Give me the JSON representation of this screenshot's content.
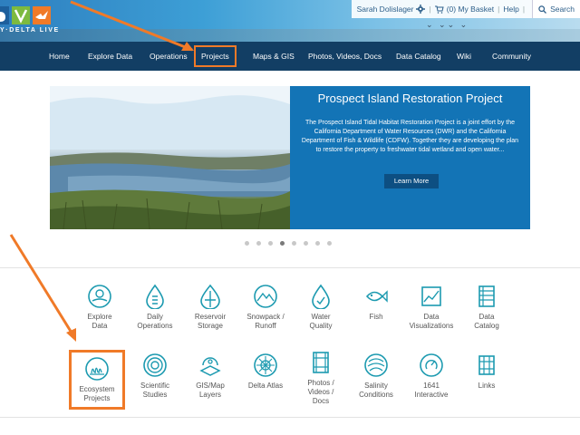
{
  "header": {
    "logo_text": "Y·DELTA LIVE",
    "user_name": "Sarah Dolislager",
    "basket": "(0) My Basket",
    "help": "Help",
    "search": "Search"
  },
  "nav": {
    "items": [
      {
        "label": "Home"
      },
      {
        "label": "Explore Data"
      },
      {
        "label": "Operations"
      },
      {
        "label": "Projects"
      },
      {
        "label": "Maps & GIS"
      },
      {
        "label": "Photos, Videos, Docs"
      },
      {
        "label": "Data Catalog"
      },
      {
        "label": "Wiki"
      },
      {
        "label": "Community"
      }
    ],
    "active": "Projects"
  },
  "hero": {
    "title": "Prospect Island Restoration Project",
    "description": "The Prospect Island Tidal Habitat Restoration Project is a joint effort by the California Department of Water Resources (DWR) and the California Department of Fish & Wildlife (CDFW). Together they are developing the plan to restore the property to freshwater tidal wetland and open water...",
    "button": "Learn More",
    "slides": 8,
    "active_slide": 4
  },
  "tiles": [
    {
      "label": "Explore\nData",
      "icon": "map-pin-icon"
    },
    {
      "label": "Daily\nOperations",
      "icon": "water-drop-icon"
    },
    {
      "label": "Reservoir\nStorage",
      "icon": "reservoir-icon"
    },
    {
      "label": "Snowpack /\nRunoff",
      "icon": "mountain-icon"
    },
    {
      "label": "Water\nQuality",
      "icon": "drop-check-icon"
    },
    {
      "label": "Fish",
      "icon": "fish-icon"
    },
    {
      "label": "Data\nVisualizations",
      "icon": "chart-icon"
    },
    {
      "label": "Data\nCatalog",
      "icon": "catalog-icon"
    },
    {
      "label": "Ecosystem\nProjects",
      "icon": "ecosystem-icon"
    },
    {
      "label": "Scientific\nStudies",
      "icon": "target-icon"
    },
    {
      "label": "GIS/Map\nLayers",
      "icon": "layers-icon"
    },
    {
      "label": "Delta Atlas",
      "icon": "compass-icon"
    },
    {
      "label": "Photos /\nVideos /\nDocs",
      "icon": "film-icon"
    },
    {
      "label": "Salinity\nConditions",
      "icon": "salinity-icon"
    },
    {
      "label": "1641\nInteractive",
      "icon": "gauge-icon"
    },
    {
      "label": "Links",
      "icon": "links-icon"
    }
  ],
  "colors": {
    "accent": "#f07a28",
    "nav": "#123e64",
    "icon": "#1c9ab0",
    "panel": "#1374b6"
  }
}
